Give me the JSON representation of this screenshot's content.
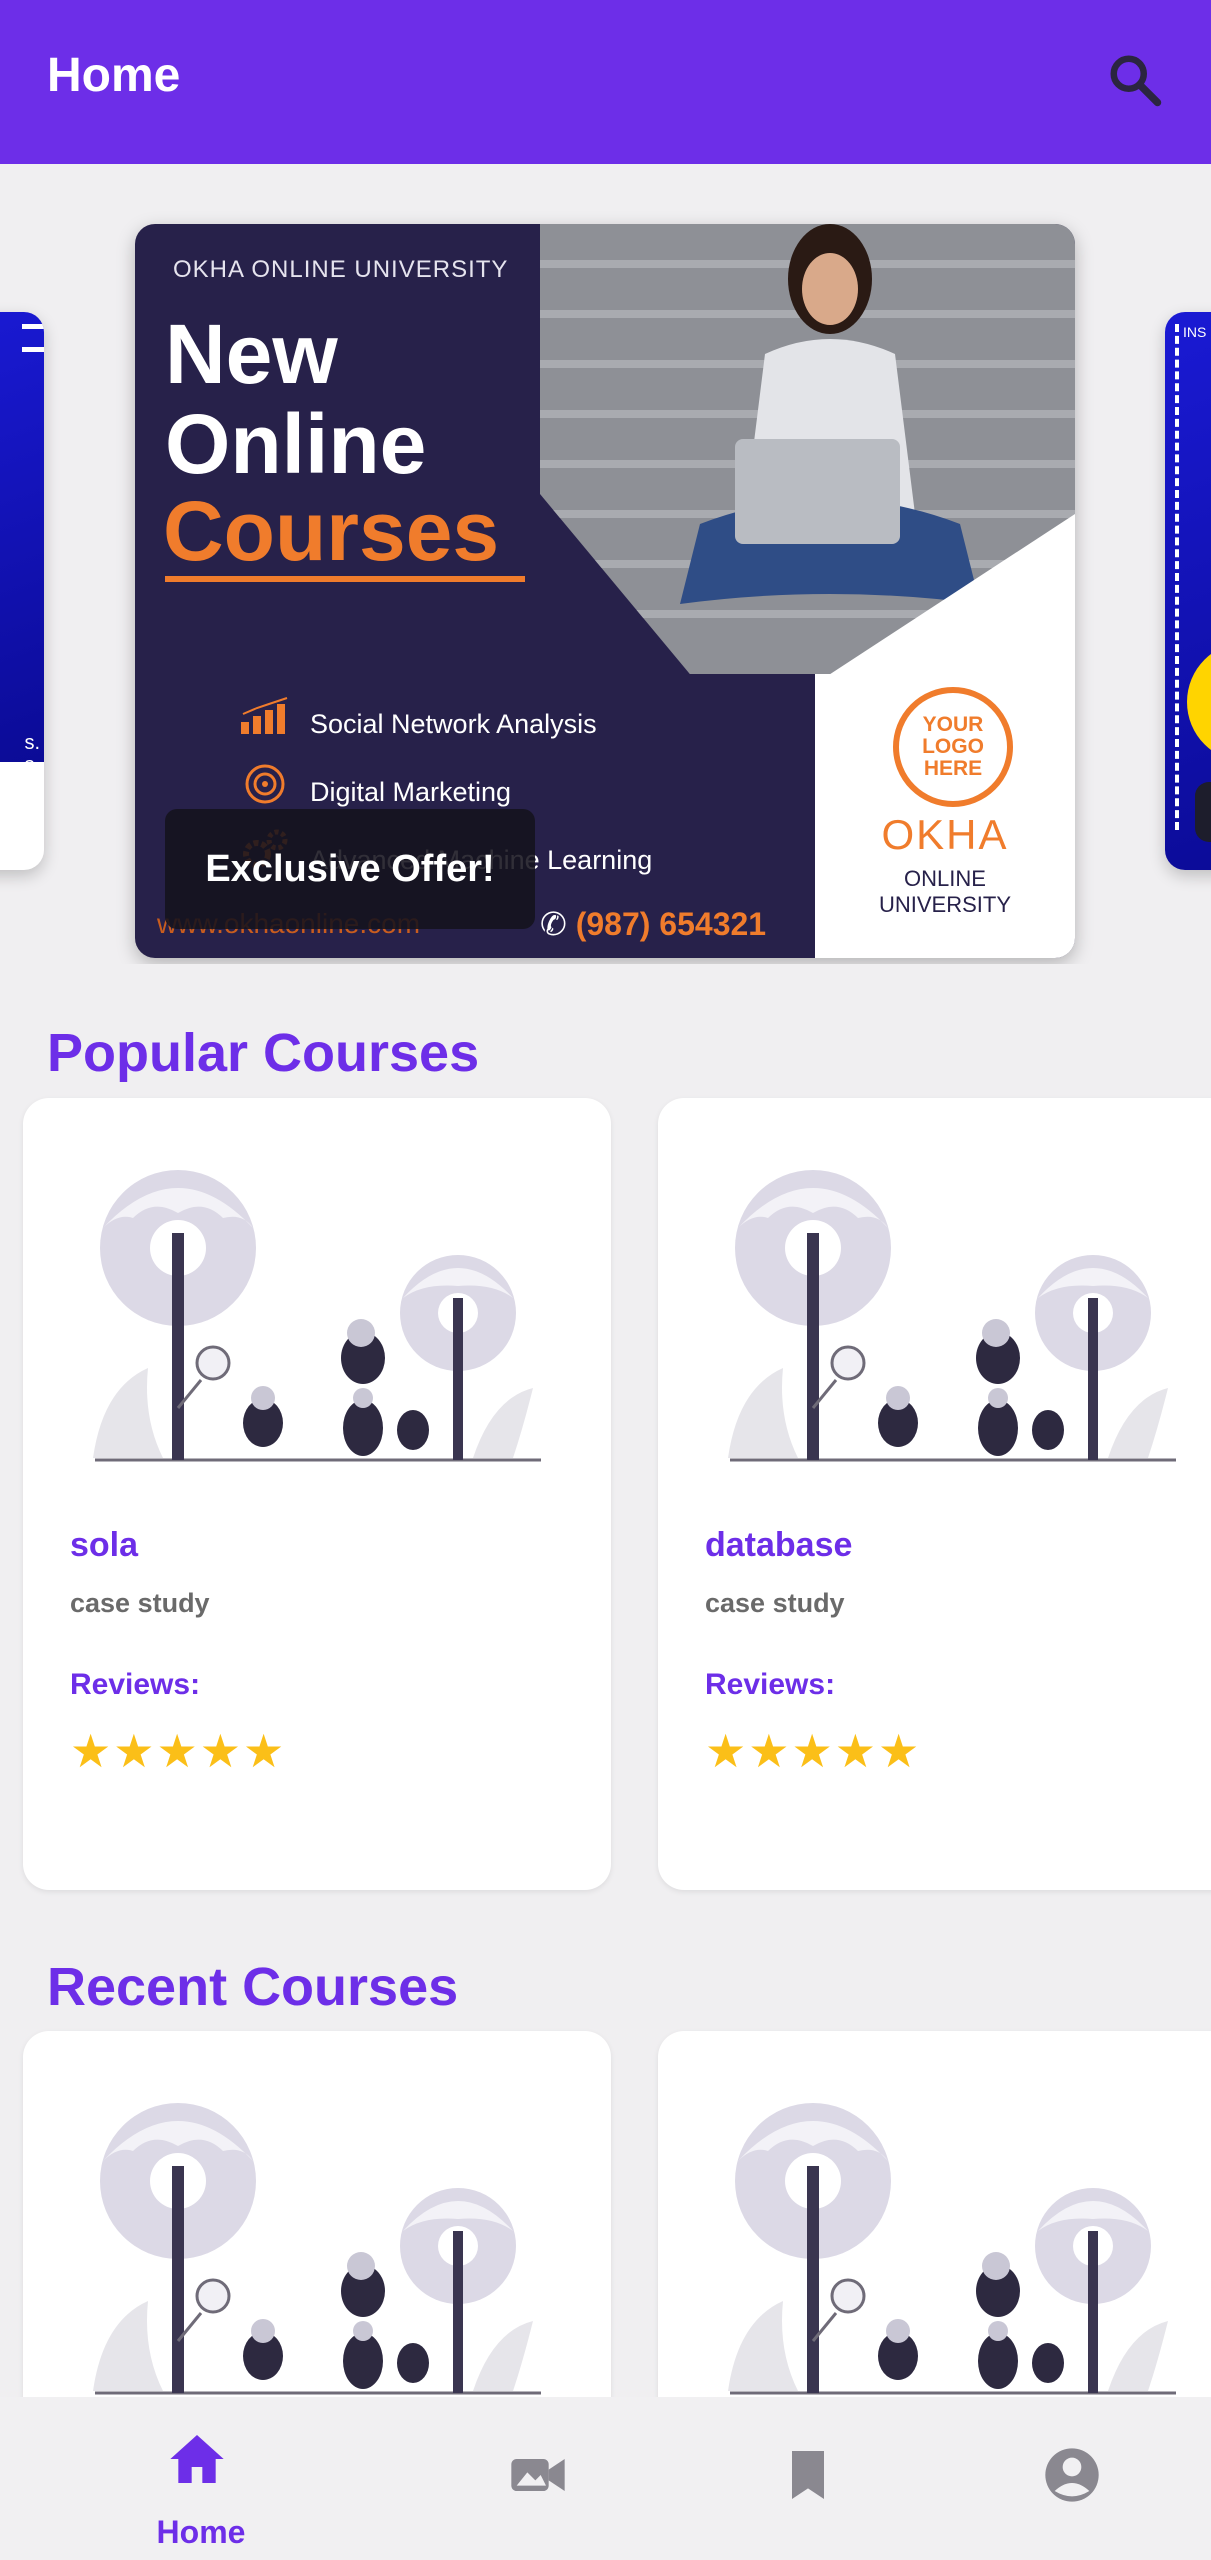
{
  "app_bar": {
    "title": "Home",
    "background": "#6d2ee8",
    "search_icon": "search-icon"
  },
  "carousel": {
    "banner": {
      "university": "OKHA ONLINE UNIVERSITY",
      "headline_line1": "New",
      "headline_line2": "Online",
      "headline_line3": "Courses",
      "items": [
        "Social Network Analysis",
        "Digital Marketing",
        "Advanced Machine Learning"
      ],
      "logo_lines": [
        "YOUR",
        "LOGO",
        "HERE"
      ],
      "brand_name": "OKHA",
      "brand_sub_line1": "ONLINE",
      "brand_sub_line2": "UNIVERSITY",
      "website": "www.okhaonline.com",
      "phone": "(987) 654321"
    },
    "caption": "Exclusive Offer!",
    "left_slide_text": "s.\ns",
    "right_slide_text": "INS"
  },
  "popular_courses": {
    "title": "Popular Courses",
    "cards": [
      {
        "title": "sola",
        "subtitle": "case study",
        "reviews_label": "Reviews:",
        "rating": 5,
        "stars": "★★★★★"
      },
      {
        "title": "database",
        "subtitle": "case study",
        "reviews_label": "Reviews:",
        "rating": 5,
        "stars": "★★★★★"
      }
    ]
  },
  "recent_courses": {
    "title": "Recent Courses"
  },
  "bottom_nav": {
    "items": [
      {
        "label": "Home",
        "icon": "home-icon",
        "active": true
      },
      {
        "label": "",
        "icon": "video-icon",
        "active": false
      },
      {
        "label": "",
        "icon": "bookmark-icon",
        "active": false
      },
      {
        "label": "",
        "icon": "account-icon",
        "active": false
      }
    ]
  },
  "colors": {
    "accent": "#6d2ee8",
    "star": "#fbbf18",
    "banner_navy": "#27214a",
    "banner_orange": "#f07c2c"
  }
}
